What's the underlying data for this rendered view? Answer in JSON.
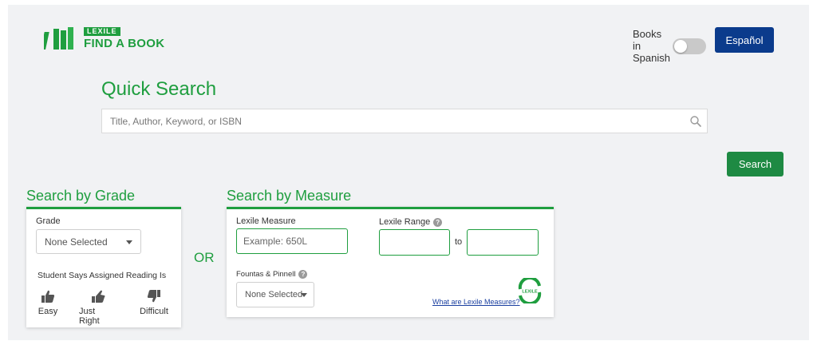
{
  "header": {
    "logo_badge": "LEXILE",
    "logo_name": "FIND A BOOK",
    "toggle_label": "Books in Spanish",
    "toggle_on": false,
    "espanol_label": "Español"
  },
  "quick_search": {
    "title": "Quick Search",
    "placeholder": "Title, Author, Keyword, or ISBN",
    "search_button": "Search"
  },
  "grade": {
    "title": "Search by Grade",
    "grade_label": "Grade",
    "grade_value": "None Selected",
    "reading_label": "Student Says Assigned Reading Is",
    "options": [
      {
        "label": "Easy"
      },
      {
        "label": "Just Right"
      },
      {
        "label": "Difficult"
      }
    ]
  },
  "or_label": "OR",
  "measure": {
    "title": "Search by Measure",
    "lexile_measure_label": "Lexile Measure",
    "lexile_measure_placeholder": "Example: 650L",
    "lexile_range_label": "Lexile Range",
    "range_to": "to",
    "fountas_label": "Fountas & Pinnell",
    "fountas_value": "None Selected",
    "what_link": "What are Lexile Measures?",
    "badge_text": "LEXILE"
  },
  "colors": {
    "brand_green": "#1f9e3f",
    "search_green": "#1e8a43",
    "espanol_blue": "#0b3b8c"
  }
}
